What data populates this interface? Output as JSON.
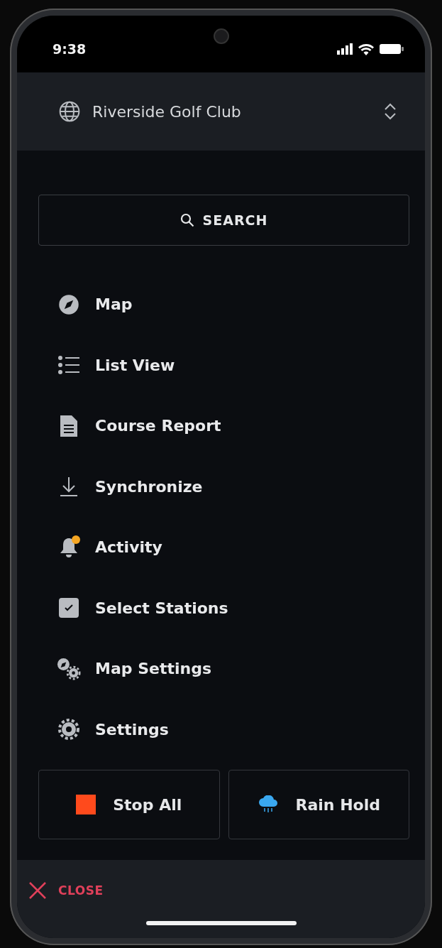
{
  "status_bar": {
    "time": "9:38"
  },
  "header": {
    "title": "Riverside Golf Club"
  },
  "search": {
    "label": "SEARCH"
  },
  "menu": [
    {
      "label": "Map",
      "notification": false
    },
    {
      "label": "List View",
      "notification": false
    },
    {
      "label": "Course Report",
      "notification": false
    },
    {
      "label": "Synchronize",
      "notification": false
    },
    {
      "label": "Activity",
      "notification": true
    },
    {
      "label": "Select Stations",
      "notification": false
    },
    {
      "label": "Map Settings",
      "notification": false
    },
    {
      "label": "Settings",
      "notification": false
    }
  ],
  "actions": [
    {
      "label": "Stop All"
    },
    {
      "label": "Rain Hold"
    }
  ],
  "footer": {
    "close": "CLOSE"
  }
}
